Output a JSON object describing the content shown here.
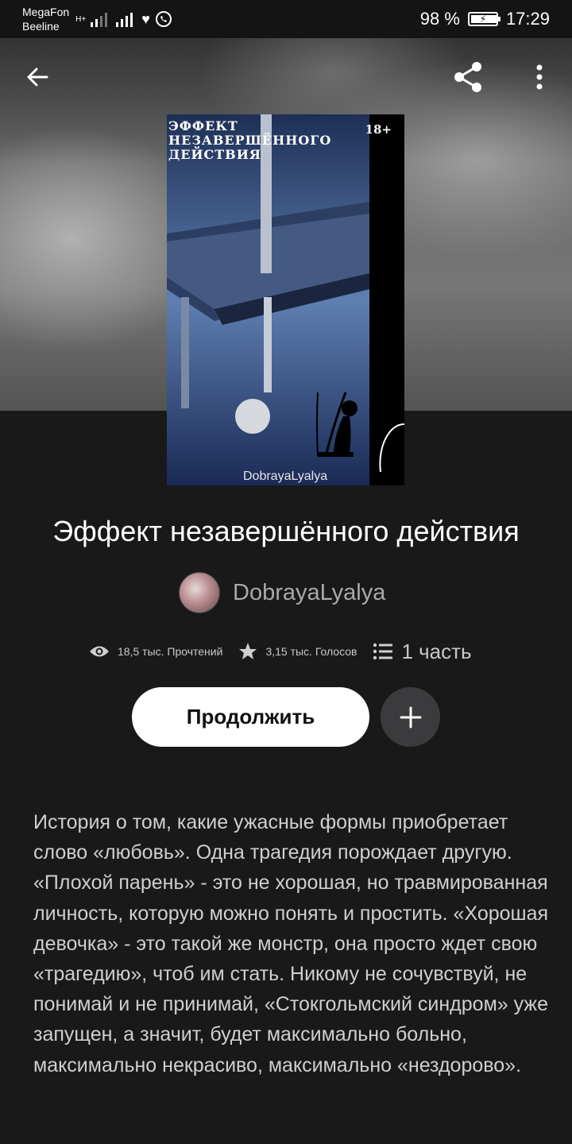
{
  "status_bar": {
    "carrier_1": "MegaFon",
    "carrier_2": "Beeline",
    "network_1": "H+",
    "battery": "98 %",
    "time": "17:29"
  },
  "cover": {
    "title": "ЭФФЕКТ НЕЗАВЕРШЁННОГО ДЕЙСТВИЯ",
    "age_rating": "18+",
    "author": "DobrayaLyalya"
  },
  "book": {
    "title": "Эффект незавершённого действия",
    "author": "DobrayaLyalya"
  },
  "stats": {
    "reads": "18,5 тыс. Прочтений",
    "votes": "3,15 тыс. Голосов",
    "parts": "1 часть"
  },
  "actions": {
    "continue_label": "Продолжить"
  },
  "description": "История о том, какие ужасные формы приобретает слово «любовь». Одна трагедия порождает другую. «Плохой парень» - это не хорошая, но травмированная личность, которую можно понять и простить. «Хорошая девочка» - это такой же монстр, она просто ждет свою «трагедию», чтоб им стать.  Никому не сочувствуй, не понимай и не принимай, «Стокгольмский синдром» уже запущен, а значит, будет максимально больно, максимально некрасиво, максимально «нездорово».",
  "icons": {
    "back": "arrow-left-icon",
    "share": "share-icon",
    "more": "more-vertical-icon",
    "views": "eye-icon",
    "votes": "star-icon",
    "parts": "list-icon",
    "add": "plus-icon"
  },
  "colors": {
    "background": "#1a191a",
    "button_primary": "#ffffff",
    "button_secondary": "#3b3b3d",
    "author_text": "#a9a9a9"
  }
}
